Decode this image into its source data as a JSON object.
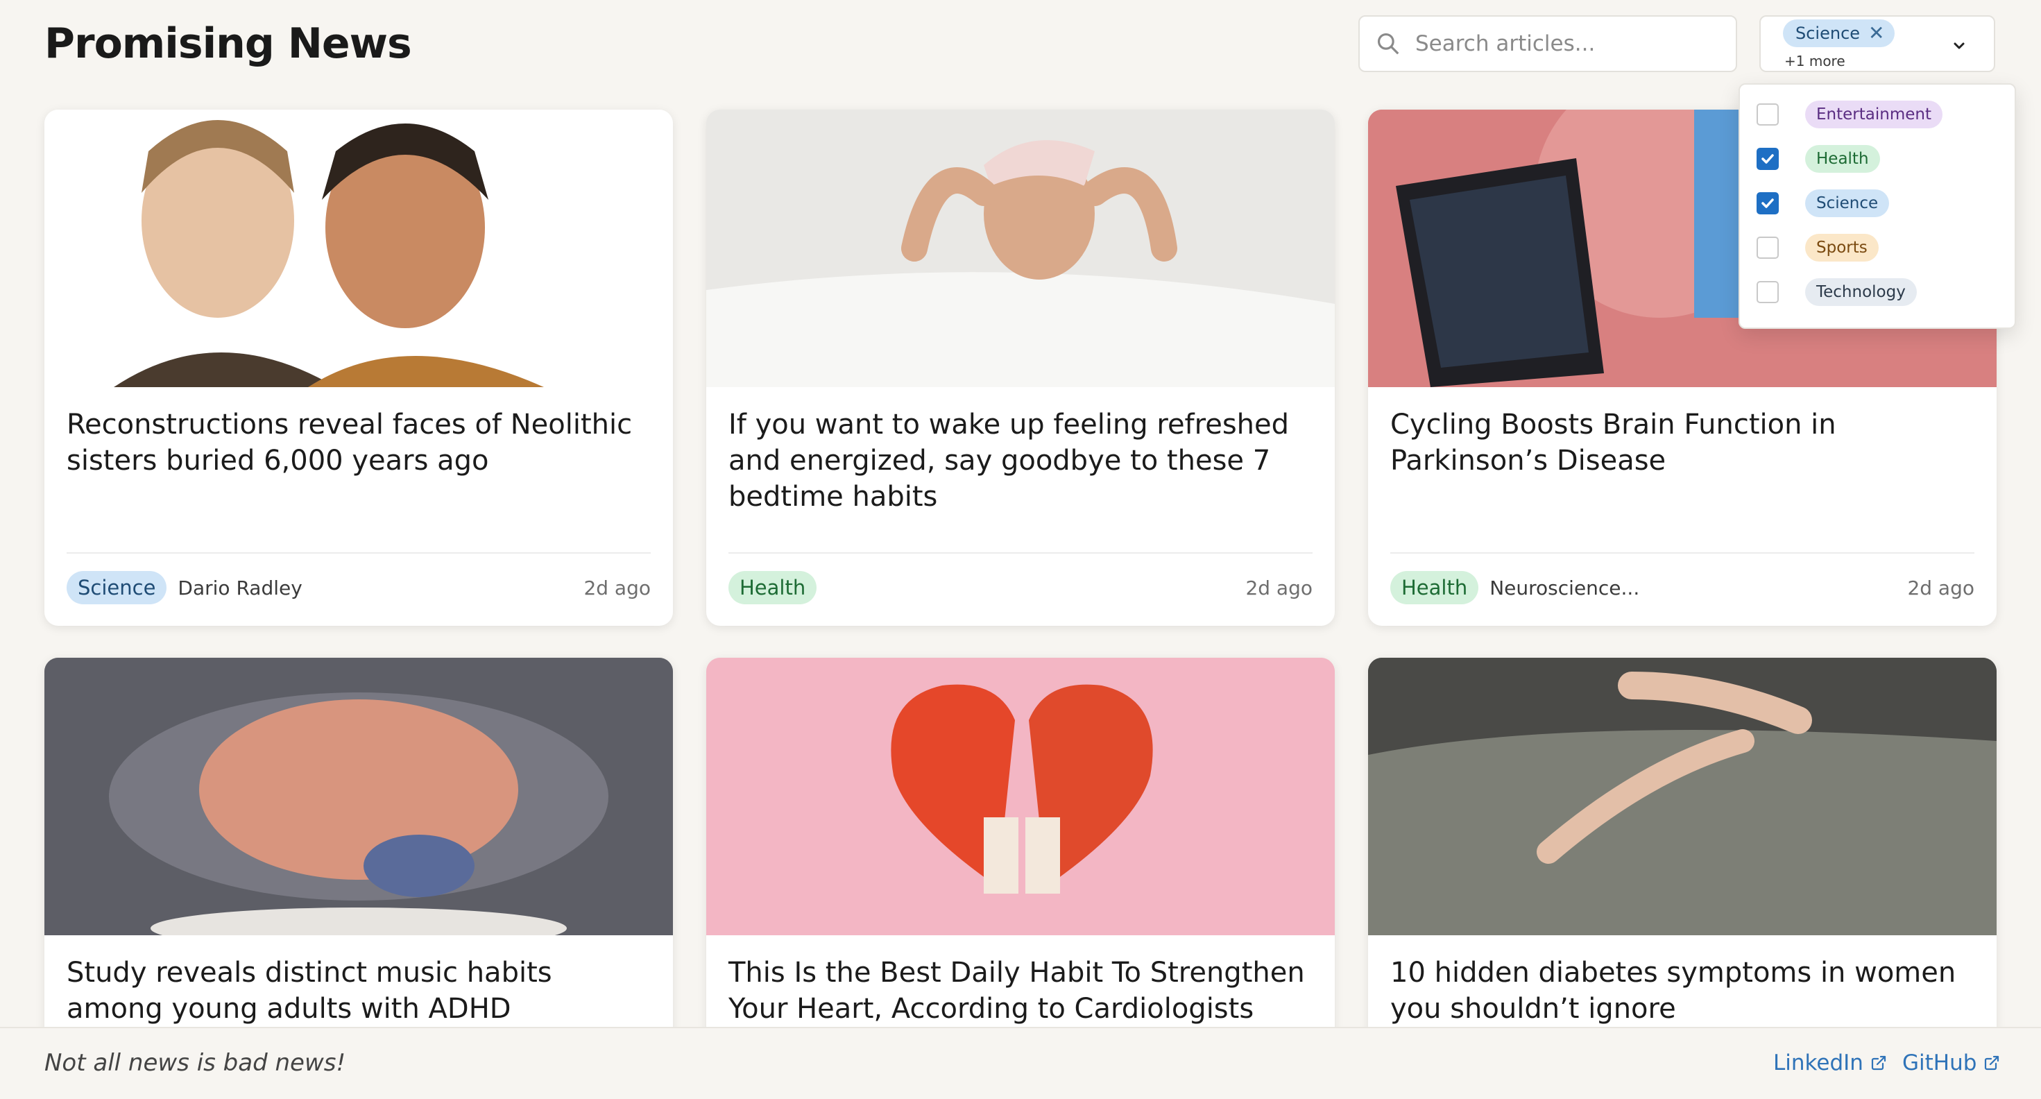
{
  "header": {
    "title": "Promising News",
    "search_placeholder": "Search articles...",
    "search_icon": "magnifier-icon"
  },
  "filter": {
    "selected_chip": "Science",
    "more_label": "+1 more",
    "options": [
      {
        "label": "Entertainment",
        "checked": false,
        "color": "#eadcf6"
      },
      {
        "label": "Health",
        "checked": true,
        "color": "#d4f1dc"
      },
      {
        "label": "Science",
        "checked": true,
        "color": "#cfe4f7"
      },
      {
        "label": "Sports",
        "checked": false,
        "color": "#fbe7c8"
      },
      {
        "label": "Technology",
        "checked": false,
        "color": "#e6ebf1"
      }
    ]
  },
  "articles": [
    {
      "title": "Reconstructions reveal faces of Neolithic sisters buried 6,000 years ago",
      "category": "Science",
      "author": "Dario Radley",
      "age": "2d ago",
      "image": "neolithic-faces"
    },
    {
      "title": "If you want to wake up feeling refreshed and energized, say goodbye to these 7 bedtime habits",
      "category": "Health",
      "author": "",
      "age": "2d ago",
      "image": "woman-waking-up"
    },
    {
      "title": "Cycling Boosts Brain Function in Parkinson’s Disease",
      "category": "Health",
      "author": "Neuroscience...",
      "age": "2d ago",
      "image": "exercise-bike-screen"
    },
    {
      "title": "Study reveals distinct music habits among young adults with ADHD symptoms",
      "category": "",
      "author": "",
      "age": "",
      "image": "brain-with-music-notes"
    },
    {
      "title": "This Is the Best Daily Habit To Strengthen Your Heart, According to Cardiologists",
      "category": "",
      "author": "",
      "age": "",
      "image": "boxing-gloves-heart"
    },
    {
      "title": "10 hidden diabetes symptoms in women you shouldn’t ignore",
      "category": "",
      "author": "",
      "age": "",
      "image": "itchy-arm-bed"
    }
  ],
  "footer": {
    "tagline": "Not all news is bad news!",
    "links": [
      "LinkedIn",
      "GitHub"
    ],
    "link_icon": "external-link-icon"
  },
  "colors": {
    "background": "#f7f5f1",
    "accent_link": "#2f73b8",
    "checkbox_checked": "#1e6fc4"
  }
}
